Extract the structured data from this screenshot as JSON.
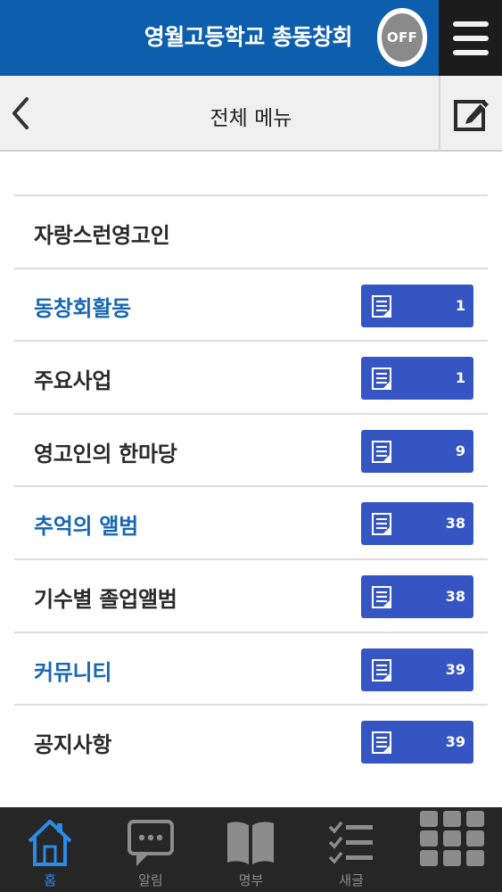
{
  "header": {
    "title": "영월고등학교 총동창회",
    "off_label": "OFF"
  },
  "subheader": {
    "title": "전체 메뉴"
  },
  "menu": [
    {
      "label": "자랑스런영고인",
      "color": "#2a2a2a",
      "count": null
    },
    {
      "label": "동창회활동",
      "color": "#1767b3",
      "count": "1"
    },
    {
      "label": "주요사업",
      "color": "#2a2a2a",
      "count": "1"
    },
    {
      "label": "영고인의 한마당",
      "color": "#2a2a2a",
      "count": "9"
    },
    {
      "label": "추억의 앨범",
      "color": "#1767b3",
      "count": "38"
    },
    {
      "label": "기수별 졸업앨범",
      "color": "#2a2a2a",
      "count": "38"
    },
    {
      "label": "커뮤니티",
      "color": "#1767b3",
      "count": "39"
    },
    {
      "label": "공지사항",
      "color": "#2a2a2a",
      "count": "39"
    }
  ],
  "tabs": [
    {
      "label": "홈",
      "icon": "home-icon",
      "active": true
    },
    {
      "label": "알림",
      "icon": "chat-bubble-icon",
      "active": false
    },
    {
      "label": "명부",
      "icon": "book-icon",
      "active": false
    },
    {
      "label": "새글",
      "icon": "checklist-icon",
      "active": false
    },
    {
      "label": "",
      "icon": "grid-icon",
      "active": false
    }
  ],
  "colors": {
    "appbar": "#0d5fad",
    "badge": "#3555c3",
    "accent_text": "#1767b3",
    "tabbar": "#262626",
    "active_tab": "#2a8be8"
  }
}
